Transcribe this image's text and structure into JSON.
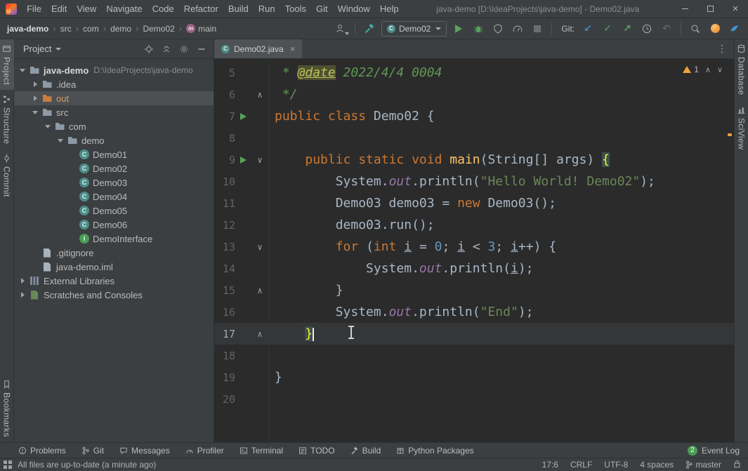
{
  "titlebar": {
    "menus": [
      "File",
      "Edit",
      "View",
      "Navigate",
      "Code",
      "Refactor",
      "Build",
      "Run",
      "Tools",
      "Git",
      "Window",
      "Help"
    ],
    "title": "java-demo [D:\\IdeaProjects\\java-demo] - Demo02.java"
  },
  "navbar": {
    "breadcrumbs": [
      "java-demo",
      "src",
      "com",
      "demo",
      "Demo02",
      "main"
    ],
    "run_config": "Demo02",
    "git_label": "Git:"
  },
  "stripes": {
    "left_top": [
      {
        "label": "Project",
        "icon": "project",
        "active": true
      },
      {
        "label": "Structure",
        "icon": "structure"
      },
      {
        "label": "Commit",
        "icon": "commit"
      }
    ],
    "left_bottom": [
      {
        "label": "Bookmarks",
        "icon": "bookmarks"
      }
    ],
    "right_top": [
      {
        "label": "Database",
        "icon": "database"
      },
      {
        "label": "SciView",
        "icon": "sciview"
      }
    ]
  },
  "project_panel": {
    "title": "Project",
    "tree": [
      {
        "label": "java-demo",
        "extra": "D:\\IdeaProjects\\java-demo",
        "level": 0,
        "icon": "folder",
        "chevron": "expanded",
        "bold": true
      },
      {
        "label": ".idea",
        "level": 1,
        "icon": "folder",
        "chevron": "collapsed"
      },
      {
        "label": "out",
        "level": 1,
        "icon": "folder-excluded",
        "chevron": "collapsed",
        "selected": true
      },
      {
        "label": "src",
        "level": 1,
        "icon": "folder",
        "chevron": "expanded"
      },
      {
        "label": "com",
        "level": 2,
        "icon": "folder",
        "chevron": "expanded"
      },
      {
        "label": "demo",
        "level": 3,
        "icon": "folder",
        "chevron": "expanded"
      },
      {
        "label": "Demo01",
        "level": 4,
        "icon": "class"
      },
      {
        "label": "Demo02",
        "level": 4,
        "icon": "class"
      },
      {
        "label": "Demo03",
        "level": 4,
        "icon": "class"
      },
      {
        "label": "Demo04",
        "level": 4,
        "icon": "class"
      },
      {
        "label": "Demo05",
        "level": 4,
        "icon": "class"
      },
      {
        "label": "Demo06",
        "level": 4,
        "icon": "class"
      },
      {
        "label": "DemoInterface",
        "level": 4,
        "icon": "interface"
      },
      {
        "label": ".gitignore",
        "level": 1,
        "icon": "file"
      },
      {
        "label": "java-demo.iml",
        "level": 1,
        "icon": "file"
      },
      {
        "label": "External Libraries",
        "level": 0,
        "icon": "library",
        "chevron": "collapsed"
      },
      {
        "label": "Scratches and Consoles",
        "level": 0,
        "icon": "scratch",
        "chevron": "collapsed"
      }
    ]
  },
  "editor": {
    "tab": "Demo02.java",
    "warning_count": "1",
    "lines": [
      {
        "n": "5",
        "segs": [
          {
            "t": " * ",
            "c": "doc"
          },
          {
            "t": "@date",
            "c": "doctag"
          },
          {
            "t": " 2022/4/4 0004",
            "c": "doc"
          }
        ]
      },
      {
        "n": "6",
        "fold": "up",
        "segs": [
          {
            "t": " */",
            "c": "doc"
          }
        ]
      },
      {
        "n": "7",
        "run": true,
        "segs": [
          {
            "t": "public class ",
            "c": "kw"
          },
          {
            "t": "Demo02 {",
            "c": "pl"
          }
        ]
      },
      {
        "n": "8",
        "segs": []
      },
      {
        "n": "9",
        "run": true,
        "fold": "down",
        "segs": [
          {
            "t": "    ",
            "c": "pl"
          },
          {
            "t": "public static void ",
            "c": "kw"
          },
          {
            "t": "main",
            "c": "fn"
          },
          {
            "t": "(String[] args) ",
            "c": "pl"
          },
          {
            "t": "{",
            "c": "brace"
          }
        ]
      },
      {
        "n": "10",
        "segs": [
          {
            "t": "        System.",
            "c": "pl"
          },
          {
            "t": "out",
            "c": "field"
          },
          {
            "t": ".println(",
            "c": "pl"
          },
          {
            "t": "\"Hello World! Demo02\"",
            "c": "str"
          },
          {
            "t": ");",
            "c": "pl"
          }
        ]
      },
      {
        "n": "11",
        "segs": [
          {
            "t": "        Demo03 demo03 = ",
            "c": "pl"
          },
          {
            "t": "new ",
            "c": "kw"
          },
          {
            "t": "Demo03();",
            "c": "pl"
          }
        ]
      },
      {
        "n": "12",
        "segs": [
          {
            "t": "        demo03.run();",
            "c": "pl"
          }
        ]
      },
      {
        "n": "13",
        "fold": "down",
        "segs": [
          {
            "t": "        ",
            "c": "pl"
          },
          {
            "t": "for ",
            "c": "kw"
          },
          {
            "t": "(",
            "c": "pl"
          },
          {
            "t": "int ",
            "c": "kw"
          },
          {
            "t": "i",
            "c": "und"
          },
          {
            "t": " = ",
            "c": "pl"
          },
          {
            "t": "0",
            "c": "num"
          },
          {
            "t": "; ",
            "c": "pl"
          },
          {
            "t": "i",
            "c": "und"
          },
          {
            "t": " < ",
            "c": "pl"
          },
          {
            "t": "3",
            "c": "num"
          },
          {
            "t": "; ",
            "c": "pl"
          },
          {
            "t": "i",
            "c": "und"
          },
          {
            "t": "++) {",
            "c": "pl"
          }
        ]
      },
      {
        "n": "14",
        "segs": [
          {
            "t": "            System.",
            "c": "pl"
          },
          {
            "t": "out",
            "c": "field"
          },
          {
            "t": ".println(",
            "c": "pl"
          },
          {
            "t": "i",
            "c": "und"
          },
          {
            "t": ");",
            "c": "pl"
          }
        ]
      },
      {
        "n": "15",
        "fold": "up",
        "segs": [
          {
            "t": "        }",
            "c": "pl"
          }
        ]
      },
      {
        "n": "16",
        "segs": [
          {
            "t": "        System.",
            "c": "pl"
          },
          {
            "t": "out",
            "c": "field"
          },
          {
            "t": ".println(",
            "c": "pl"
          },
          {
            "t": "\"End\"",
            "c": "str"
          },
          {
            "t": ");",
            "c": "pl"
          }
        ]
      },
      {
        "n": "17",
        "fold": "up",
        "current": true,
        "caret": true,
        "segs": [
          {
            "t": "    ",
            "c": "pl"
          },
          {
            "t": "}",
            "c": "brace"
          }
        ]
      },
      {
        "n": "18",
        "segs": []
      },
      {
        "n": "19",
        "segs": [
          {
            "t": "}",
            "c": "pl"
          }
        ]
      },
      {
        "n": "20",
        "segs": []
      }
    ]
  },
  "bottom_bar": {
    "items": [
      {
        "label": "Problems",
        "icon": "problems"
      },
      {
        "label": "Git",
        "icon": "git"
      },
      {
        "label": "Messages",
        "icon": "messages"
      },
      {
        "label": "Profiler",
        "icon": "profiler"
      },
      {
        "label": "Terminal",
        "icon": "terminal"
      },
      {
        "label": "TODO",
        "icon": "todo"
      },
      {
        "label": "Build",
        "icon": "build"
      },
      {
        "label": "Python Packages",
        "icon": "python"
      }
    ],
    "event_log": "Event Log",
    "event_badge": "2"
  },
  "status_bar": {
    "message": "All files are up-to-date (a minute ago)",
    "caret": "17:6",
    "line_ending": "CRLF",
    "encoding": "UTF-8",
    "indent": "4 spaces",
    "branch": "master"
  },
  "colors": {
    "keyword": "#cc7832",
    "string": "#6a8759",
    "number": "#6897bb",
    "method": "#ffc66b",
    "doc_comment": "#629755",
    "run_green": "#57a35c",
    "warning_orange": "#f0a13c",
    "excluded_folder_orange": "#c87d41"
  }
}
